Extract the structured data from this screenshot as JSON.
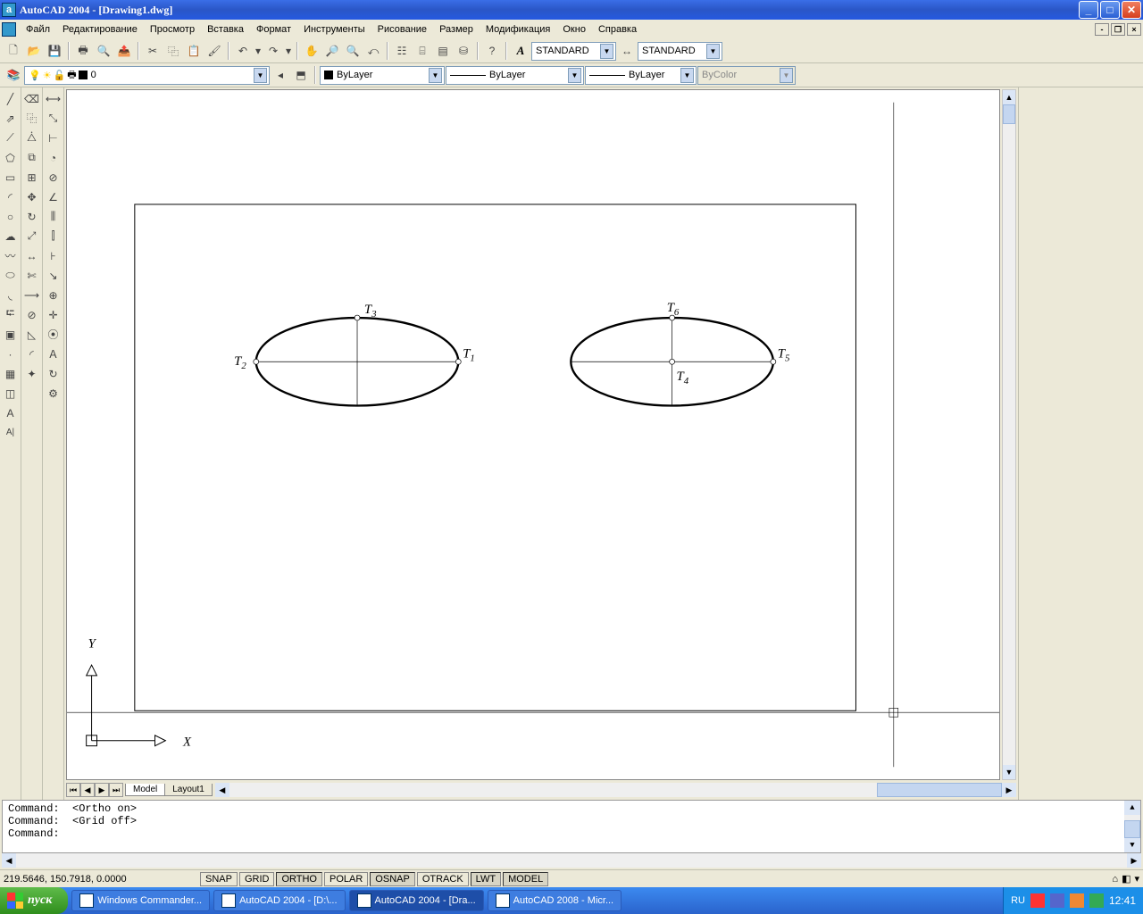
{
  "title": "AutoCAD 2004 - [Drawing1.dwg]",
  "menu": [
    "Файл",
    "Редактирование",
    "Просмотр",
    "Вставка",
    "Формат",
    "Инструменты",
    "Рисование",
    "Размер",
    "Модификация",
    "Окно",
    "Справка"
  ],
  "styles": {
    "textstyle": "STANDARD",
    "dimstyle": "STANDARD"
  },
  "layer": {
    "current": "0",
    "linetype": "ByLayer",
    "lineweight": "ByLayer",
    "plotstyle": "ByLayer",
    "color": "ByColor"
  },
  "tabs": {
    "model": "Model",
    "layout1": "Layout1"
  },
  "command": {
    "line1": "Command:  <Ortho on>",
    "line2": "Command:  <Grid off>",
    "prompt": "Command:"
  },
  "status": {
    "coords": "219.5646, 150.7918, 0.0000",
    "snap": "SNAP",
    "grid": "GRID",
    "ortho": "ORTHO",
    "polar": "POLAR",
    "osnap": "OSNAP",
    "otrack": "OTRACK",
    "lwt": "LWT",
    "model": "MODEL"
  },
  "taskbar": {
    "start": "пуск",
    "items": [
      "Windows Commander...",
      "AutoCAD 2004 - [D:\\...",
      "AutoCAD 2004 - [Dra...",
      "AutoCAD 2008 - Micr..."
    ],
    "lang": "RU",
    "clock": "12:41"
  },
  "drawing": {
    "axis_x": "X",
    "axis_y": "Y",
    "labels": {
      "t1": "T",
      "t1s": "1",
      "t2": "T",
      "t2s": "2",
      "t3": "T",
      "t3s": "3",
      "t4": "T",
      "t4s": "4",
      "t5": "T",
      "t5s": "5",
      "t6": "T",
      "t6s": "6"
    }
  }
}
